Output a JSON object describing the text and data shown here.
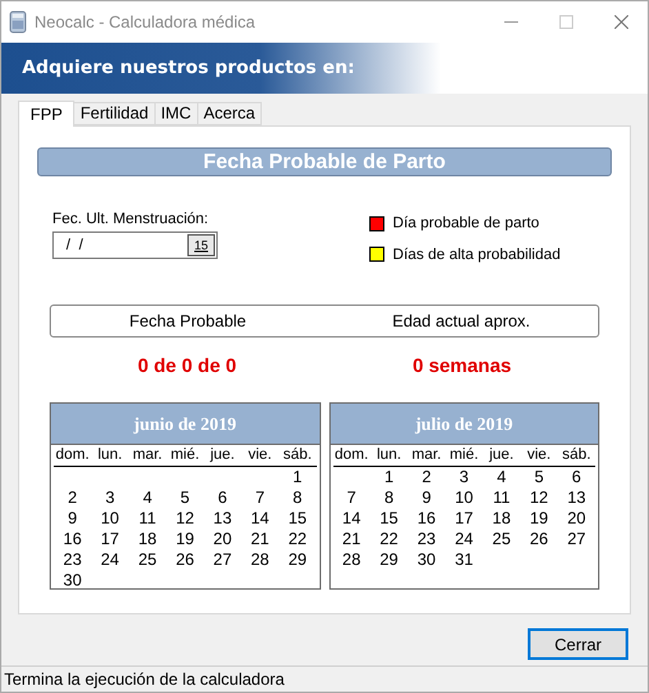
{
  "window": {
    "title": "Neocalc - Calculadora médica"
  },
  "banner": {
    "text": "Adquiere nuestros productos en:"
  },
  "tabs": [
    {
      "label": "FPP",
      "selected": true
    },
    {
      "label": "Fertilidad",
      "selected": false
    },
    {
      "label": "IMC",
      "selected": false
    },
    {
      "label": "Acerca",
      "selected": false
    }
  ],
  "heading": "Fecha Probable de Parto",
  "date_field": {
    "label": "Fec. Ult. Menstruación:",
    "value": " /  /",
    "button": "15"
  },
  "legend": [
    {
      "label": "Día probable de parto",
      "color": "#ff0000"
    },
    {
      "label": "Días de alta probabilidad",
      "color": "#ffff00"
    }
  ],
  "results": {
    "headers": [
      "Fecha Probable",
      "Edad actual aprox."
    ],
    "values": [
      "0 de 0 de 0",
      "0 semanas"
    ]
  },
  "calendars": [
    {
      "title": "junio de 2019",
      "weekdays": [
        "dom.",
        "lun.",
        "mar.",
        "mié.",
        "jue.",
        "vie.",
        "sáb."
      ],
      "weeks": [
        {
          "kind": "first",
          "days": [
            "1"
          ]
        },
        {
          "kind": "full",
          "days": [
            "2",
            "3",
            "4",
            "5",
            "6",
            "7",
            "8"
          ]
        },
        {
          "kind": "full",
          "days": [
            "9",
            "10",
            "11",
            "12",
            "13",
            "14",
            "15"
          ]
        },
        {
          "kind": "full",
          "days": [
            "16",
            "17",
            "18",
            "19",
            "20",
            "21",
            "22"
          ]
        },
        {
          "kind": "full",
          "days": [
            "23",
            "24",
            "25",
            "26",
            "27",
            "28",
            "29"
          ]
        },
        {
          "kind": "last",
          "days": [
            "30"
          ]
        }
      ]
    },
    {
      "title": "julio de 2019",
      "weekdays": [
        "dom.",
        "lun.",
        "mar.",
        "mié.",
        "jue.",
        "vie.",
        "sáb."
      ],
      "weeks": [
        {
          "kind": "first",
          "days": [
            "1",
            "2",
            "3",
            "4",
            "5",
            "6"
          ]
        },
        {
          "kind": "full",
          "days": [
            "7",
            "8",
            "9",
            "10",
            "11",
            "12",
            "13"
          ]
        },
        {
          "kind": "full",
          "days": [
            "14",
            "15",
            "16",
            "17",
            "18",
            "19",
            "20"
          ]
        },
        {
          "kind": "full",
          "days": [
            "21",
            "22",
            "23",
            "24",
            "25",
            "26",
            "27"
          ]
        },
        {
          "kind": "last",
          "days": [
            "28",
            "29",
            "30",
            "31"
          ]
        }
      ]
    }
  ],
  "buttons": [
    {
      "label": "Cerrar"
    }
  ],
  "status_bar": {
    "text": "Termina la ejecución de la calculadora"
  }
}
